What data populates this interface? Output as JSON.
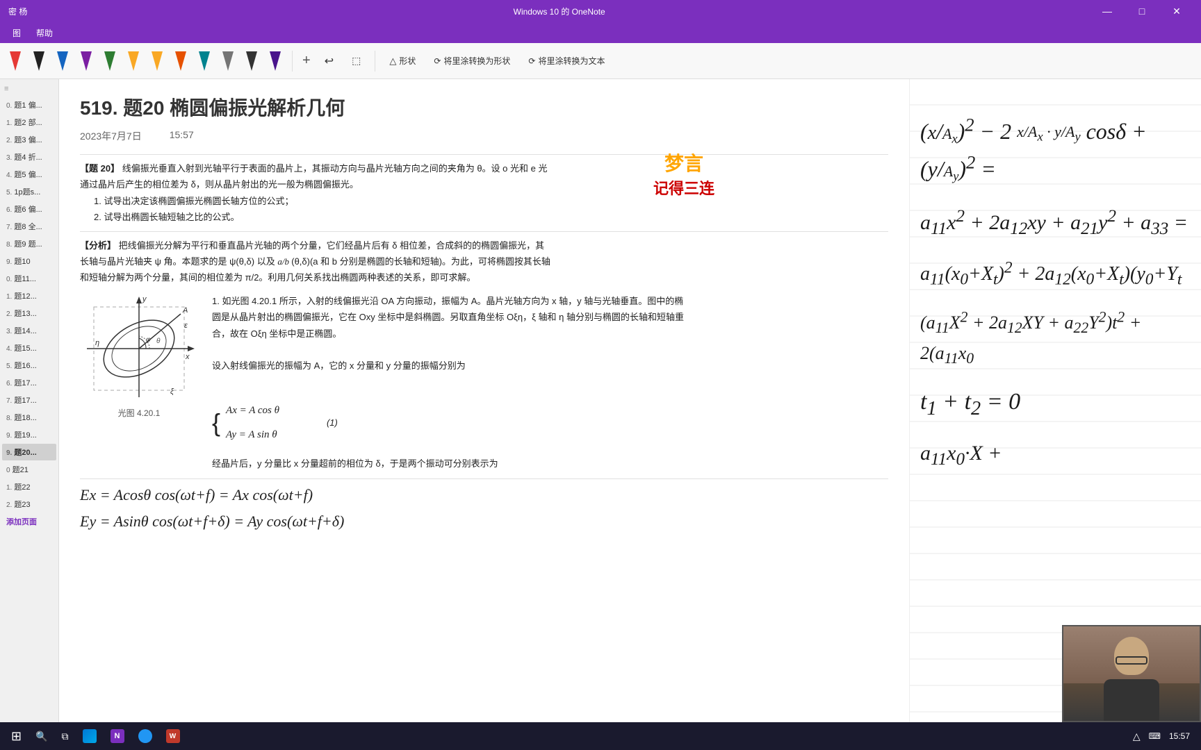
{
  "titlebar": {
    "title": "Windows 10 的 OneNote",
    "user": "密 杨",
    "min_btn": "—",
    "max_btn": "□",
    "close_btn": "✕"
  },
  "menubar": {
    "items": [
      "图",
      "帮助"
    ]
  },
  "toolbar": {
    "shape_btn": "形状",
    "convert_to_shape": "将里涂转换为形状",
    "convert_to_text": "将里涂转换为文本",
    "plus_btn": "+",
    "undo_btn": "↩",
    "lasso_btn": "⬚"
  },
  "sidebar": {
    "items": [
      {
        "number": "0.",
        "label": "题1 偏..."
      },
      {
        "number": "1.",
        "label": "题2 部..."
      },
      {
        "number": "2.",
        "label": "题3 偏..."
      },
      {
        "number": "3.",
        "label": "题4 折..."
      },
      {
        "number": "4.",
        "label": "题5 偏..."
      },
      {
        "number": "5.",
        "label": "1p题s..."
      },
      {
        "number": "6.",
        "label": "题6 偏..."
      },
      {
        "number": "7.",
        "label": "题8 全..."
      },
      {
        "number": "8.",
        "label": "题9 题..."
      },
      {
        "number": "9.",
        "label": "题10"
      },
      {
        "number": "0.",
        "label": "题11..."
      },
      {
        "number": "1.",
        "label": "题12..."
      },
      {
        "number": "2.",
        "label": "题13..."
      },
      {
        "number": "3.",
        "label": "题14..."
      },
      {
        "number": "4.",
        "label": "题15..."
      },
      {
        "number": "5.",
        "label": "题16..."
      },
      {
        "number": "6.",
        "label": "题17..."
      },
      {
        "number": "7.",
        "label": "题17..."
      },
      {
        "number": "8.",
        "label": "题18..."
      },
      {
        "number": "9.",
        "label": "题19..."
      },
      {
        "number": "9.",
        "label": "题20...",
        "active": true
      },
      {
        "number": "0",
        "label": "题21"
      },
      {
        "number": "1.",
        "label": "题22"
      },
      {
        "number": "2.",
        "label": "题23"
      },
      {
        "number": "",
        "label": "添加页面"
      }
    ]
  },
  "page": {
    "title": "519.  题20 椭圆偏振光解析几何",
    "date": "2023年7月7日",
    "time": "15:57",
    "name_stamp": "梦言",
    "name_stamp_sub": "记得三连",
    "topic_label": "【题 20】",
    "topic_text": "线偏振光垂直入射到光轴平行于表面的晶片上，其振动方向与晶片光轴方向之间的夹角为 θ。设 o 光和 e 光通过晶片后产生的相位差为 δ，则从晶片射出的光一般为椭圆偏振光。",
    "q1": "1. 试导出决定该椭圆偏振光椭圆长轴方位的公式；",
    "q2": "2. 试导出椭圆长轴短轴之比的公式。",
    "analysis_label": "【分析】",
    "analysis_text": "把线偏振光分解为平行和垂直晶片光轴的两个分量，它们经晶片后有 δ 相位差，合成斜的的椭圆偏振光，其长轴与晶片光轴夹 ψ 角。本题求的是 ψ(θ,δ) 以及",
    "analysis_text2": "(θ,δ)(a 和 b 分别是椭圆的长轴和短轴)。为此，可将椭圆按其长轴和短轴分解为两个分量，其间的相位差为 π/2。利用几何关系找出椭圆两种表述的关系，即可求解。",
    "analysis_1": "1. 如光图 4.20.1 所示，入射的线偏振光沿 OA 方向振动，振幅为 A。晶片光轴方向为 x 轴，y 轴与光轴垂直。图中的椭圆是从晶片射出的椭圆偏振光，它在 Oxy 坐标中是斜椭圆。另取直角坐标 Oξη，ξ 轴和 η 轴分别与椭圆的长轴和短轴重合，故在 Oξη 坐标中是正椭圆。",
    "analysis_2": "设入射线偏振光的振幅为 A，它的 x 分量和 y 分量的振幅分别为",
    "brace_eq1": "Ax = A cos θ",
    "brace_eq2": "Ay = A sin θ",
    "eq_number": "(1)",
    "caption": "光图 4.20.1",
    "analysis_3": "经晶片后，y 分量比 x 分量超前的相位为 δ，于是两个振动可分别表示为",
    "eq_Ex": "Ex = Acosθ  cos(ωt+f)  = Ax cos(ωt+f)",
    "eq_Ey": "Ey = Asinθ  cos(ωt+f+δ) = Ay cos(ωt+f+δ)"
  },
  "right_panel": {
    "eq1": "(x/Ax)² - 2(x/Ax)(y/Ay)cosδ + (y/Ay)² =",
    "eq2": "a₁₁x² + 2a₁₂xy + a₂₁y² + a₃₃ =",
    "eq3": "a₁₁(x₀+Xt)² + 2a₁₂(x₀+Xt)(y₀+Yt",
    "eq4": "(a₁₁X² + 2a₁₂XY + a₂₂Y²)t² + 2(a₁₁x₀",
    "eq5": "t₁ + t₂ = 0",
    "eq6": "a₁₁x₀·X +"
  },
  "taskbar": {
    "time": "15:57",
    "notifications": "△",
    "start": "⊞"
  }
}
